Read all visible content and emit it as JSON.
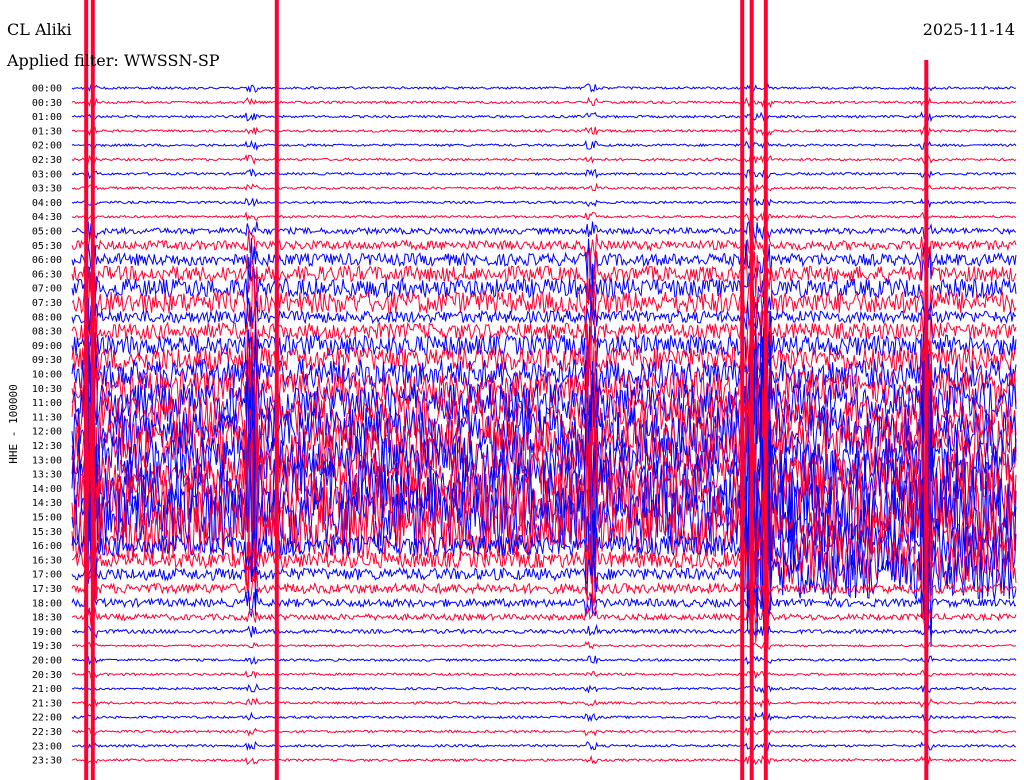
{
  "header": {
    "station": "CL Aliki",
    "date": "2025-11-14",
    "filter": "Applied filter: WWSSN-SP"
  },
  "chart_data": {
    "type": "line",
    "title": "CL Aliki",
    "ylabel": "HHE - 100000",
    "rows": [
      "00:00",
      "00:30",
      "01:00",
      "01:30",
      "02:00",
      "02:30",
      "03:00",
      "03:30",
      "04:00",
      "04:30",
      "05:00",
      "05:30",
      "06:00",
      "06:30",
      "07:00",
      "07:30",
      "08:00",
      "08:30",
      "09:00",
      "09:30",
      "10:00",
      "10:30",
      "11:00",
      "11:30",
      "12:00",
      "12:30",
      "13:00",
      "13:30",
      "14:00",
      "14:30",
      "15:00",
      "15:30",
      "16:00",
      "16:30",
      "17:00",
      "17:30",
      "18:00",
      "18:30",
      "19:00",
      "19:30",
      "20:00",
      "20:30",
      "21:00",
      "21:30",
      "22:00",
      "22:30",
      "23:00",
      "23:30"
    ],
    "row_minutes": 30,
    "colors": [
      "#0000ff",
      "#ff0033"
    ],
    "grid": false
  }
}
